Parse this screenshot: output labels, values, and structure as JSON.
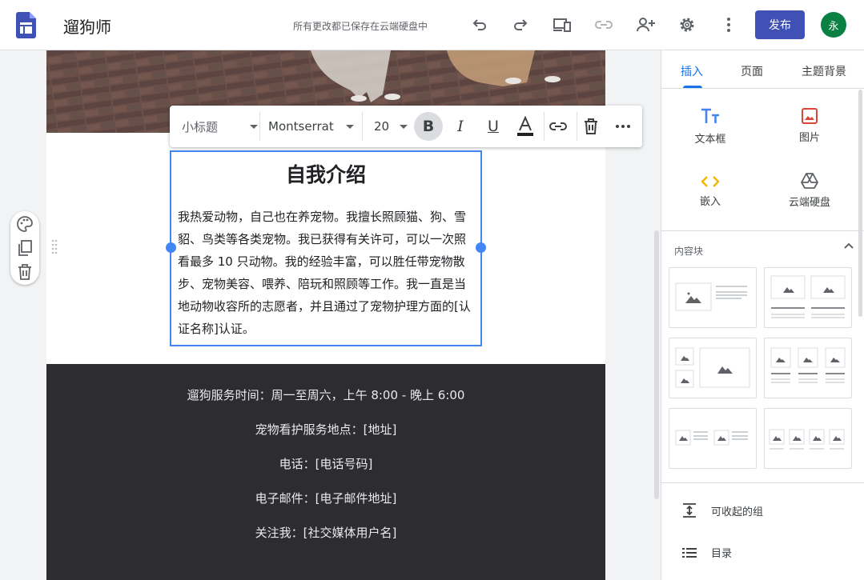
{
  "app": {
    "title": "遛狗师",
    "save_status": "所有更改都已保存在云端硬盘中",
    "publish_label": "发布",
    "avatar_initial": "永",
    "accent": "#3f51b5"
  },
  "toolbar_icons": [
    "undo-icon",
    "redo-icon",
    "preview-icon",
    "link-icon",
    "share-icon",
    "settings-icon",
    "more-icon"
  ],
  "format_toolbar": {
    "style": "小标题",
    "font": "Montserrat",
    "size": "20",
    "buttons": [
      "bold-icon",
      "italic-icon",
      "underline-icon",
      "text-color-icon",
      "link-icon",
      "delete-icon",
      "more-icon"
    ]
  },
  "content": {
    "heading": "自我介绍",
    "body": "我热爱动物，自己也在养宠物。我擅长照顾猫、狗、雪貂、鸟类等各类宠物。我已获得有关许可，可以一次照看最多 10 只动物。我的经验丰富，可以胜任带宠物散步、宠物美容、喂养、陪玩和照顾等工作。我一直是当地动物收容所的志愿者，并且通过了宠物护理方面的[认证名称]认证。"
  },
  "footer": {
    "lines": [
      "遛狗服务时间：周一至周六，上午 8:00 - 晚上 6:00",
      "宠物看护服务地点：[地址]",
      "电话：[电话号码]",
      "电子邮件：[电子邮件地址]",
      "关注我：[社交媒体用户名]"
    ]
  },
  "panel": {
    "tabs": [
      "插入",
      "页面",
      "主题背景"
    ],
    "active_tab": "插入",
    "insert_items": [
      {
        "label": "文本框",
        "icon": "text-box-icon"
      },
      {
        "label": "图片",
        "icon": "image-icon"
      },
      {
        "label": "嵌入",
        "icon": "embed-icon"
      },
      {
        "label": "云端硬盘",
        "icon": "drive-icon"
      }
    ],
    "content_blocks_title": "内容块",
    "list_items": [
      {
        "label": "可收起的组",
        "icon": "collapsible-group-icon"
      },
      {
        "label": "目录",
        "icon": "table-of-contents-icon"
      }
    ]
  }
}
